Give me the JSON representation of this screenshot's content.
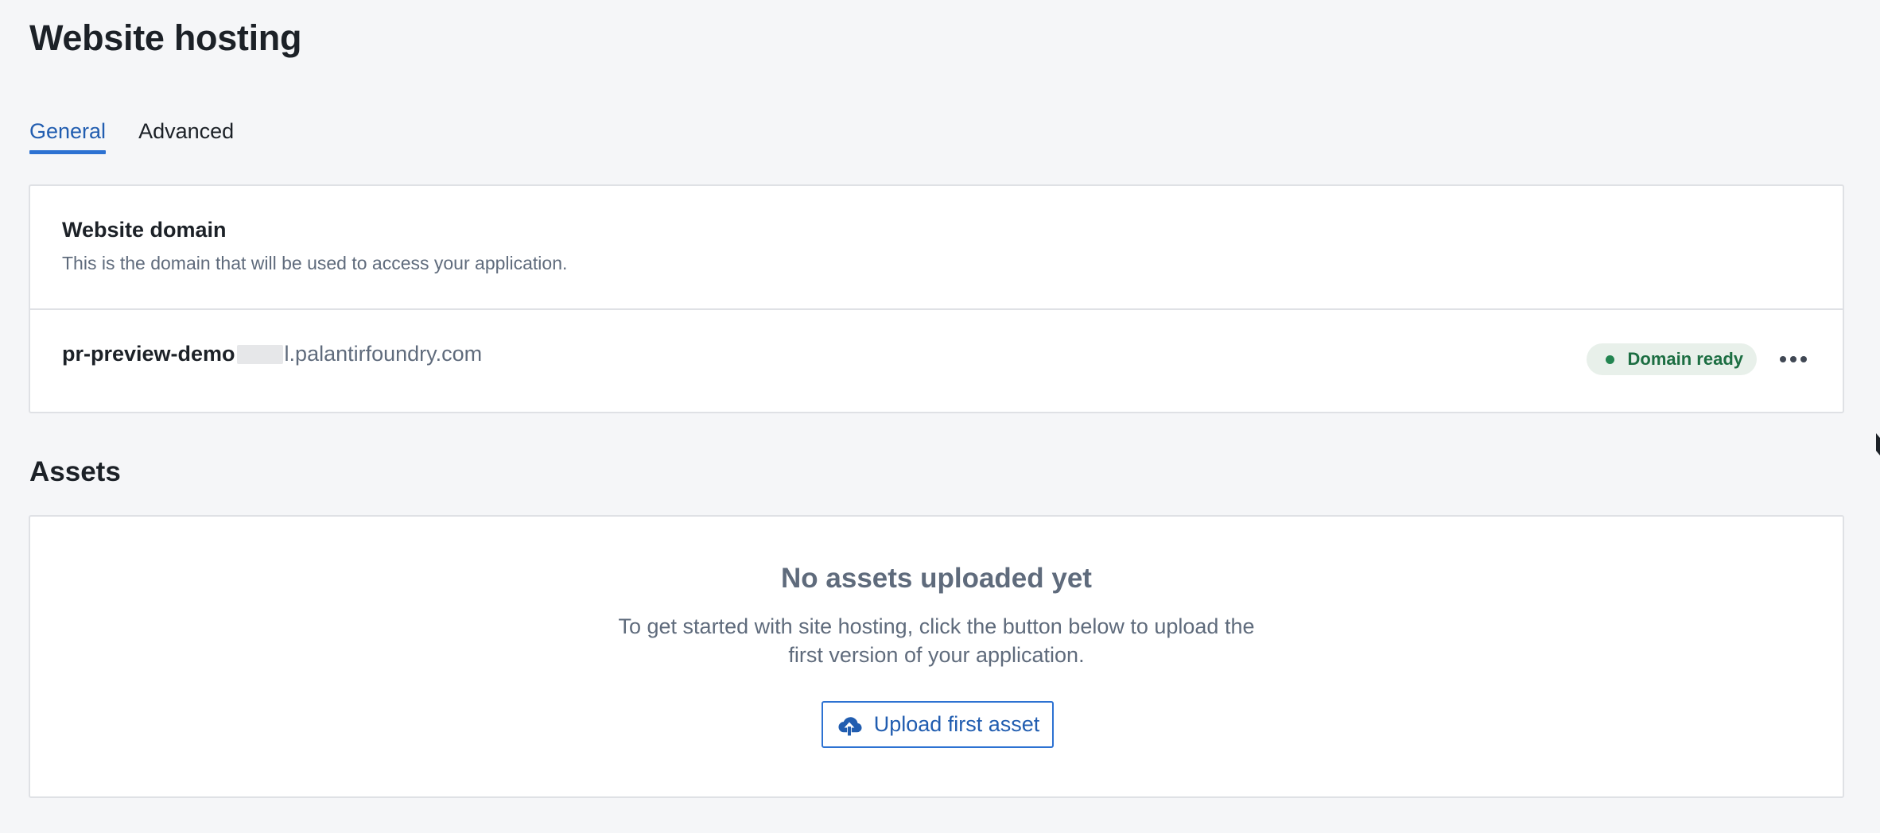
{
  "page": {
    "title": "Website hosting"
  },
  "tabs": [
    {
      "label": "General",
      "active": true
    },
    {
      "label": "Advanced",
      "active": false
    }
  ],
  "domain_section": {
    "heading": "Website domain",
    "description": "This is the domain that will be used to access your application.",
    "domain": {
      "subdomain": "pr-preview-demo",
      "suffix": "l.palantirfoundry.com"
    },
    "status": {
      "label": "Domain ready",
      "color": "#238551"
    },
    "more_icon": "more-horizontal-icon"
  },
  "assets_section": {
    "title": "Assets",
    "empty_title": "No assets uploaded yet",
    "empty_description": "To get started with site hosting, click the button below to upload the first version of your application.",
    "upload_button": {
      "label": "Upload first asset",
      "icon": "cloud-upload-icon"
    }
  },
  "colors": {
    "accent": "#2d72d2",
    "accent_text": "#215db0",
    "success": "#238551",
    "background": "#f5f6f8"
  }
}
